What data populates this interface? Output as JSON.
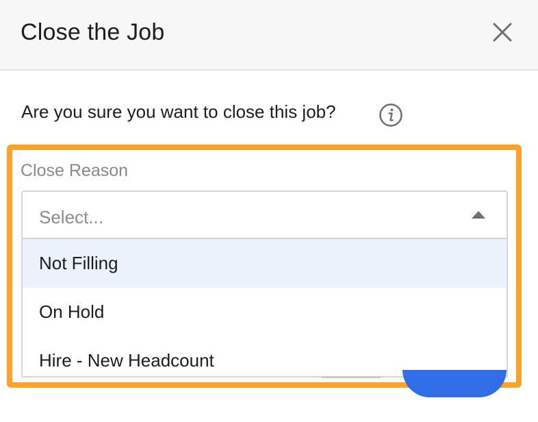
{
  "modal": {
    "title": "Close the Job",
    "close_icon": "close-x-icon",
    "question": "Are you sure you want to close this job?",
    "info_icon": "info-circle-icon"
  },
  "close_reason": {
    "label": "Close Reason",
    "placeholder": "Select...",
    "caret_icon": "caret-up-icon",
    "options": [
      {
        "label": "Not Filling",
        "highlighted": true
      },
      {
        "label": "On Hold",
        "highlighted": false
      },
      {
        "label": "Hire - New Headcount",
        "highlighted": false
      }
    ]
  },
  "colors": {
    "highlight_border": "#fba22a",
    "option_hover": "#ecf2fb",
    "primary_button": "#2f6ee6",
    "header_bg": "#f7f7f7"
  }
}
